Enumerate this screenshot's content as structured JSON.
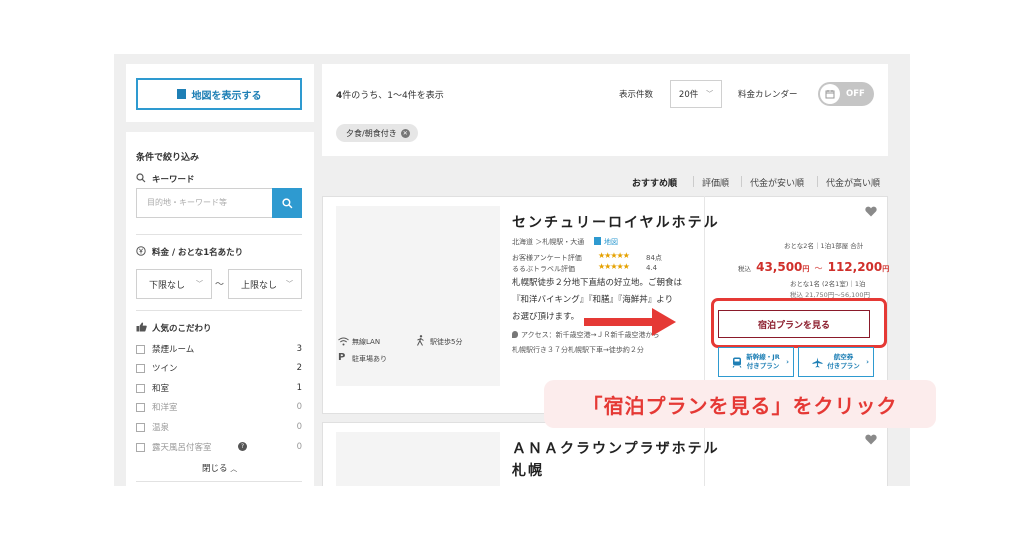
{
  "sidebar": {
    "map_button": "地図を表示する",
    "filter_title": "条件で絞り込み",
    "keyword": {
      "label": "キーワード",
      "placeholder": "目的地・キーワード等"
    },
    "price": {
      "label": "料金 / おとな1名あたり",
      "min": "下限なし",
      "tilde": "～",
      "max": "上限なし"
    },
    "popular": {
      "label": "人気のこだわり",
      "items": [
        {
          "label": "禁煙ルーム",
          "count": "3"
        },
        {
          "label": "ツイン",
          "count": "2"
        },
        {
          "label": "和室",
          "count": "1"
        },
        {
          "label": "和洋室",
          "count": "0"
        },
        {
          "label": "温泉",
          "count": "0"
        },
        {
          "label": "露天風呂付客室",
          "count": "0"
        }
      ],
      "close_label": "閉じる"
    }
  },
  "results": {
    "summary_bold": "4",
    "summary_rest": "件のうち、1〜4件を表示",
    "per_page_label": "表示件数",
    "per_page_value": "20件",
    "calendar_label": "料金カレンダー",
    "calendar_toggle": "OFF",
    "filter_chip": "夕食/朝食付き",
    "sort": [
      "おすすめ順",
      "評価順",
      "代金が安い順",
      "代金が高い順"
    ]
  },
  "hotels": [
    {
      "name": "センチュリーロイヤルホテル",
      "location": "北海道 ＞札幌駅・大通",
      "map_link": "地図",
      "rating1_label": "お客様アンケート評価",
      "rating1_value": "84点",
      "rating2_label": "るるぶトラベル評価",
      "rating2_value": "4.4",
      "description": [
        "札幌駅徒歩２分地下直結の好立地。ご朝食は",
        "『和洋バイキング』『和膳』『海鮮丼』より",
        "お選び頂けます。"
      ],
      "access": [
        "アクセス：新千歳空港→ＪＲ新千歳空港から",
        "札幌駅行き３７分札幌駅下車→徒歩約２分"
      ],
      "amenities": [
        "無線LAN",
        "駅徒歩5分",
        "駐車場あり"
      ],
      "guests1": "おとな2名｜1泊1部屋 合計",
      "tax_label": "税込",
      "price_low": "43,500",
      "price_unit": "円",
      "price_sep": "～",
      "price_high": "112,200",
      "guests2": "おとな1名 (2名1室)｜1泊",
      "price_per": "税込 21,750円～56,100円",
      "plan_button": "宿泊プランを見る",
      "sub_buttons": [
        {
          "line1": "新幹線・JR",
          "line2": "付きプラン"
        },
        {
          "line1": "航空券",
          "line2": "付きプラン"
        }
      ]
    },
    {
      "name_line1": "ＡＮＡクラウンプラザホテル",
      "name_line2": "札幌"
    }
  ],
  "annotation": {
    "callout": "「宿泊プランを見る」をクリック"
  },
  "colors": {
    "accent_blue": "#2e9ad0",
    "highlight_red": "#e53935",
    "plan_button": "#8a1a2a",
    "price_red": "#d0302b"
  }
}
